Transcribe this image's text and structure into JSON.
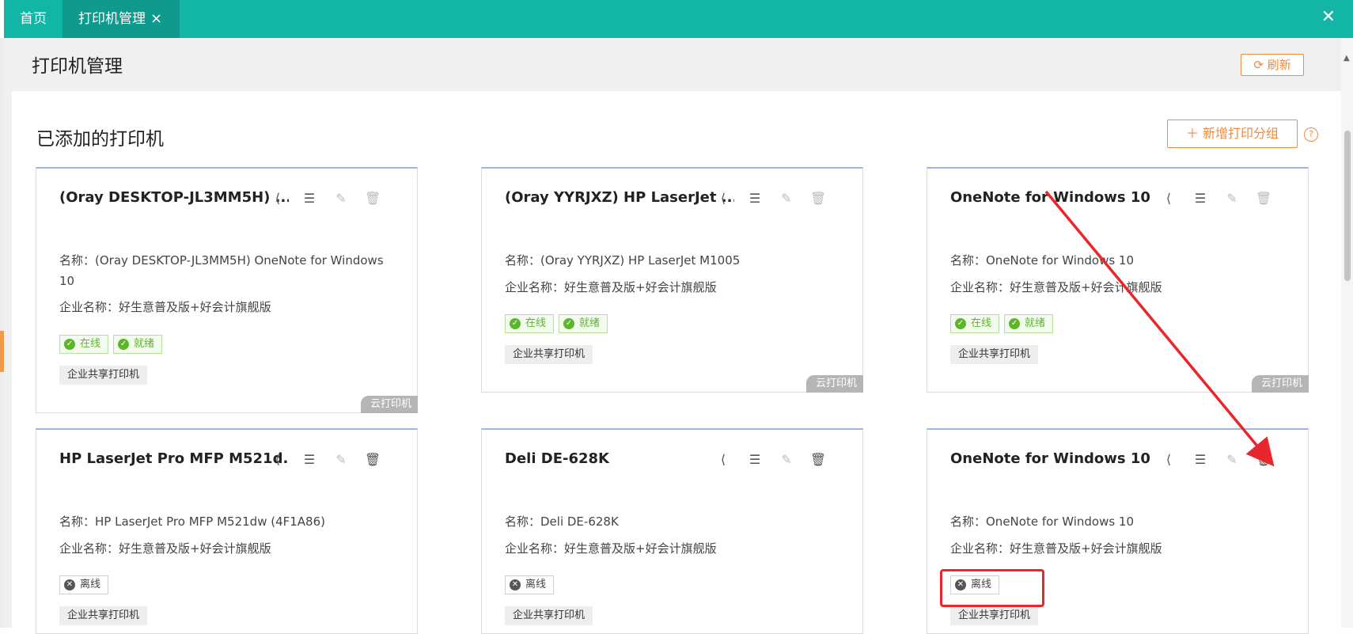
{
  "tabs": {
    "home": "首页",
    "active": "打印机管理",
    "close_glyph": "×"
  },
  "window_close": "✕",
  "page": {
    "title": "打印机管理",
    "refresh": "刷新",
    "section_title": "已添加的打印机",
    "add_group": "新增打印分组",
    "help": "?"
  },
  "colors": {
    "tab_bar": "#13b5a7",
    "accent": "#f08a3e",
    "online": "#5cb52b",
    "annotation_red": "#e8262b"
  },
  "cards": [
    {
      "title": "(Oray DESKTOP-JL3MM5H) ...",
      "name": "名称：(Oray DESKTOP-JL3MM5H) OneNote for Windows 10",
      "company": "企业名称：好生意普及版+好会计旗舰版",
      "status": [
        "在线",
        "就绪"
      ],
      "share": "企业共享打印机",
      "cloud": "云打印机"
    },
    {
      "title": "(Oray YYRJXZ) HP LaserJet ...",
      "name": "名称：(Oray YYRJXZ) HP LaserJet M1005",
      "company": "企业名称：好生意普及版+好会计旗舰版",
      "status": [
        "在线",
        "就绪"
      ],
      "share": "企业共享打印机",
      "cloud": "云打印机"
    },
    {
      "title": "OneNote for Windows 10",
      "name": "名称：OneNote for Windows 10",
      "company": "企业名称：好生意普及版+好会计旗舰版",
      "status": [
        "在线",
        "就绪"
      ],
      "share": "企业共享打印机",
      "cloud": "云打印机"
    },
    {
      "title": "HP LaserJet Pro MFP M521d...",
      "name": "名称：HP LaserJet Pro MFP M521dw (4F1A86)",
      "company": "企业名称：好生意普及版+好会计旗舰版",
      "status": [
        "离线"
      ],
      "share": "企业共享打印机"
    },
    {
      "title": "Deli DE-628K",
      "name": "名称：Deli DE-628K",
      "company": "企业名称：好生意普及版+好会计旗舰版",
      "status": [
        "离线"
      ],
      "share": "企业共享打印机"
    },
    {
      "title": "OneNote for Windows 10",
      "name": "名称：OneNote for Windows 10",
      "company": "企业名称：好生意普及版+好会计旗舰版",
      "status": [
        "离线"
      ],
      "share": "企业共享打印机"
    }
  ],
  "icons": [
    "share-icon",
    "list-icon",
    "edit-icon",
    "delete-icon",
    "check-circle-icon",
    "x-circle-icon",
    "refresh-icon",
    "plus-icon",
    "help-icon"
  ]
}
